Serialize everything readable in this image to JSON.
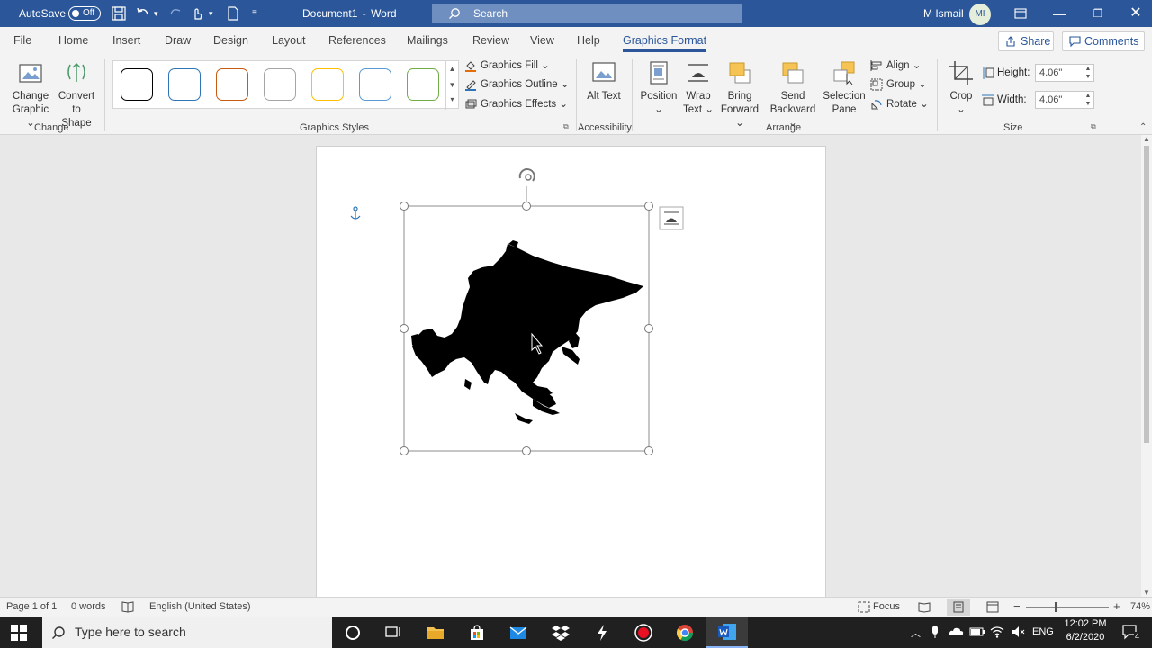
{
  "titlebar": {
    "autosave_label": "AutoSave",
    "autosave_state": "Off",
    "doc_title": "Document1",
    "separator": "-",
    "app_name": "Word",
    "search_placeholder": "Search",
    "user_name": "M Ismail",
    "user_initials": "MI"
  },
  "tabs": [
    {
      "label": "File"
    },
    {
      "label": "Home"
    },
    {
      "label": "Insert"
    },
    {
      "label": "Draw"
    },
    {
      "label": "Design"
    },
    {
      "label": "Layout"
    },
    {
      "label": "References"
    },
    {
      "label": "Mailings"
    },
    {
      "label": "Review"
    },
    {
      "label": "View"
    },
    {
      "label": "Help"
    },
    {
      "label": "Graphics Format"
    }
  ],
  "share_label": "Share",
  "comments_label": "Comments",
  "ribbon": {
    "change_graphic": "Change Graphic",
    "convert_to_shape": "Convert to Shape",
    "group_change": "Change",
    "group_graphics_styles": "Graphics Styles",
    "style_colors": [
      "#000000",
      "#2e75b6",
      "#c55a11",
      "#a5a5a5",
      "#ffc000",
      "#5b9bd5",
      "#70ad47"
    ],
    "graphics_fill": "Graphics Fill",
    "graphics_outline": "Graphics Outline",
    "graphics_effects": "Graphics Effects",
    "alt_text": "Alt Text",
    "group_accessibility": "Accessibility",
    "position": "Position",
    "wrap_text": "Wrap Text",
    "bring_forward": "Bring Forward",
    "send_backward": "Send Backward",
    "selection_pane": "Selection Pane",
    "align": "Align",
    "group": "Group",
    "rotate": "Rotate",
    "group_arrange": "Arrange",
    "crop": "Crop",
    "height_label": "Height:",
    "height_value": "4.06\"",
    "width_label": "Width:",
    "width_value": "4.06\"",
    "group_size": "Size"
  },
  "status": {
    "page": "Page 1 of 1",
    "words": "0 words",
    "language": "English (United States)",
    "focus": "Focus",
    "zoom": "74%"
  },
  "taskbar": {
    "search_placeholder": "Type here to search",
    "lang": "ENG",
    "time": "12:02 PM",
    "date": "6/2/2020",
    "notifications": "4"
  }
}
